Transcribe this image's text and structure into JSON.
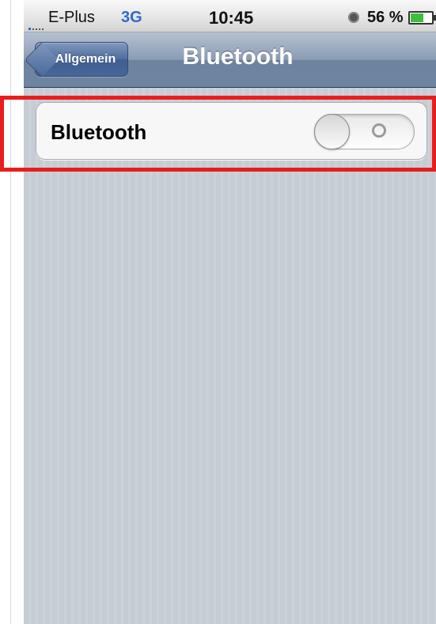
{
  "status_bar": {
    "carrier": "E-Plus",
    "network": "3G",
    "time": "10:45",
    "battery_percent": "56 %",
    "battery_level": 0.56,
    "icons": [
      "signal-icon",
      "lock-rotation-icon",
      "battery-icon"
    ]
  },
  "nav_bar": {
    "back_label": "Allgemein",
    "title": "Bluetooth"
  },
  "settings": {
    "bluetooth_label": "Bluetooth",
    "bluetooth_enabled": false
  },
  "colors": {
    "highlight": "#e81e1e",
    "network": "#2f6bc6",
    "battery_fill": "#3dbf3d"
  }
}
